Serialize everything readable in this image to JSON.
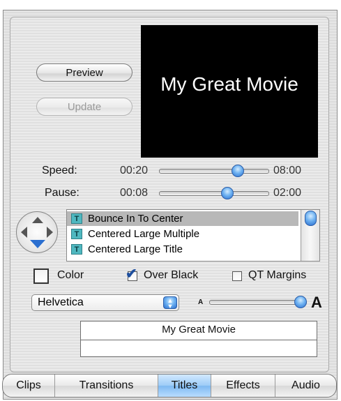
{
  "buttons": {
    "preview": "Preview",
    "update": "Update"
  },
  "preview_text": "My Great Movie",
  "speed": {
    "label": "Speed:",
    "min": "00:20",
    "max": "08:00",
    "level": 0.7
  },
  "pause": {
    "label": "Pause:",
    "min": "00:08",
    "max": "02:00",
    "level": 0.6
  },
  "titles_list": [
    {
      "label": "Bounce In To Center",
      "selected": true
    },
    {
      "label": "Centered Large Multiple",
      "selected": false
    },
    {
      "label": "Centered Large Title",
      "selected": false
    }
  ],
  "options": {
    "color": {
      "label": "Color",
      "checked": false
    },
    "over_black": {
      "label": "Over Black",
      "checked": true
    },
    "qt_margins": {
      "label": "QT Margins",
      "checked": false
    }
  },
  "font": {
    "selected": "Helvetica"
  },
  "size_slider": {
    "small_glyph": "A",
    "large_glyph": "A",
    "level": 1.0
  },
  "title_text": {
    "line1": "My Great Movie",
    "line2": ""
  },
  "tabs": [
    {
      "label": "Clips",
      "active": false
    },
    {
      "label": "Transitions",
      "active": false
    },
    {
      "label": "Titles",
      "active": true
    },
    {
      "label": "Effects",
      "active": false
    },
    {
      "label": "Audio",
      "active": false
    }
  ],
  "colors": {
    "accent": "#6fb2f1",
    "preview_bg": "#000000",
    "list_selection": "#b8b8b8"
  },
  "icons": [
    "direction-pad-icon",
    "title-t-icon",
    "popup-arrows-icon",
    "check-icon"
  ]
}
